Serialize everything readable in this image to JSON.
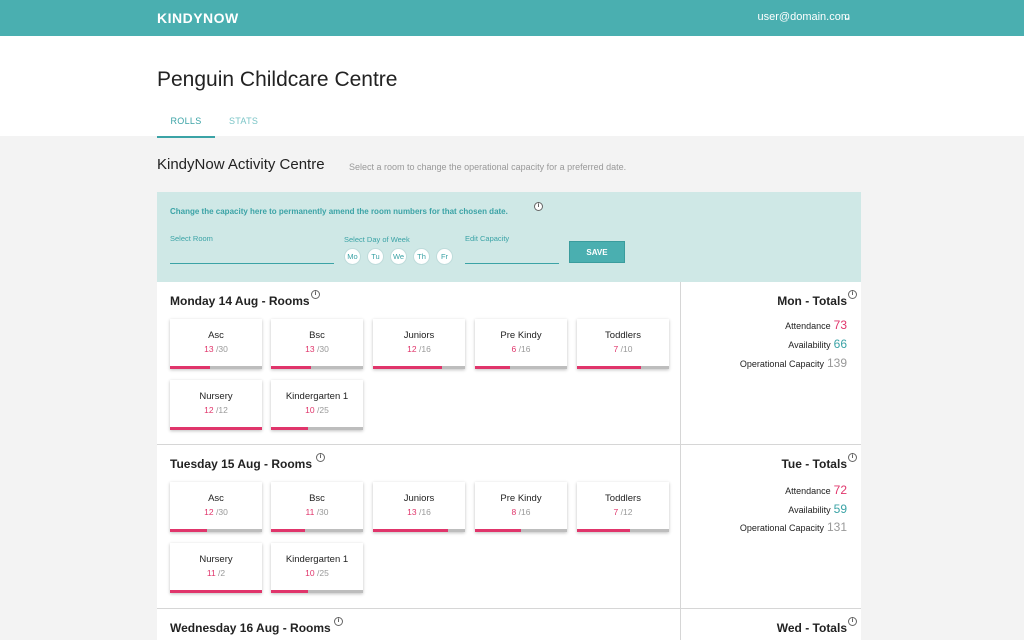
{
  "app": {
    "brand": "KINDYNOW",
    "user_email": "user@domain.com"
  },
  "page": {
    "title": "Penguin Childcare Centre",
    "tabs": [
      {
        "label": "ROLLS",
        "active": true
      },
      {
        "label": "STATS",
        "active": false
      }
    ]
  },
  "section": {
    "title": "KindyNow Activity Centre",
    "hint": "Select a room to change the operational capacity for a preferred date."
  },
  "edit_panel": {
    "note": "Change the capacity here to permanently amend the room numbers for that chosen date.",
    "select_room_label": "Select Room",
    "select_day_label": "Select Day of Week",
    "days": [
      "Mo",
      "Tu",
      "We",
      "Th",
      "Fr"
    ],
    "edit_capacity_label": "Edit Capacity",
    "save_label": "SAVE"
  },
  "days": [
    {
      "title": "Monday 14 Aug - Rooms",
      "totals_title": "Mon - Totals",
      "rooms": [
        {
          "name": "Asc",
          "count": "13",
          "capacity": "/30",
          "fill": 0.43
        },
        {
          "name": "Bsc",
          "count": "13",
          "capacity": "/30",
          "fill": 0.43
        },
        {
          "name": "Juniors",
          "count": "12",
          "capacity": "/16",
          "fill": 0.75
        },
        {
          "name": "Pre Kindy",
          "count": "6",
          "capacity": "/16",
          "fill": 0.38
        },
        {
          "name": "Toddlers",
          "count": "7",
          "capacity": "/10",
          "fill": 0.7
        },
        {
          "name": "Nursery",
          "count": "12",
          "capacity": "/12",
          "fill": 1.0
        },
        {
          "name": "Kindergarten 1",
          "count": "10",
          "capacity": "/25",
          "fill": 0.4
        }
      ],
      "totals": {
        "attendance_label": "Attendance",
        "attendance": "73",
        "availability_label": "Availability",
        "availability": "66",
        "op_label": "Operational Capacity",
        "op_capacity": "139"
      }
    },
    {
      "title": "Tuesday 15 Aug - Rooms",
      "totals_title": "Tue - Totals",
      "rooms": [
        {
          "name": "Asc",
          "count": "12",
          "capacity": "/30",
          "fill": 0.4
        },
        {
          "name": "Bsc",
          "count": "11",
          "capacity": "/30",
          "fill": 0.37
        },
        {
          "name": "Juniors",
          "count": "13",
          "capacity": "/16",
          "fill": 0.81
        },
        {
          "name": "Pre Kindy",
          "count": "8",
          "capacity": "/16",
          "fill": 0.5
        },
        {
          "name": "Toddlers",
          "count": "7",
          "capacity": "/12",
          "fill": 0.58
        },
        {
          "name": "Nursery",
          "count": "11",
          "capacity": "/2",
          "fill": 1.0
        },
        {
          "name": "Kindergarten 1",
          "count": "10",
          "capacity": "/25",
          "fill": 0.4
        }
      ],
      "totals": {
        "attendance_label": "Attendance",
        "attendance": "72",
        "availability_label": "Availability",
        "availability": "59",
        "op_label": "Operational Capacity",
        "op_capacity": "131"
      }
    },
    {
      "title": "Wednesday 16 Aug - Rooms",
      "totals_title": "Wed - Totals"
    }
  ]
}
